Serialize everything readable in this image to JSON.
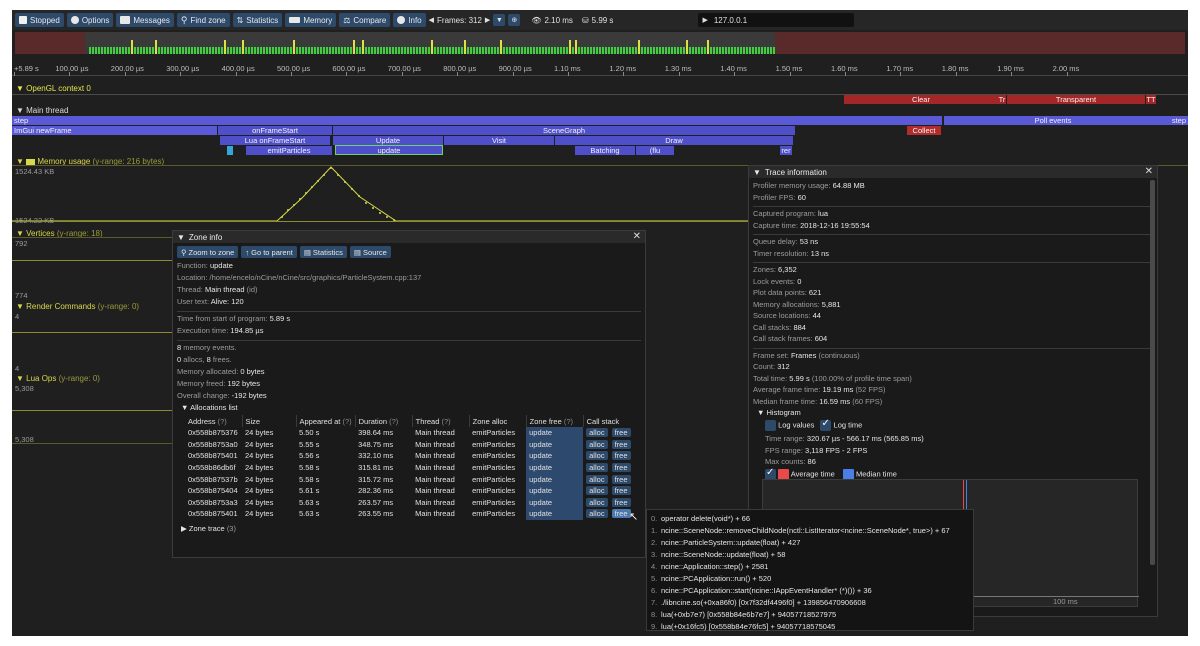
{
  "toolbar": {
    "stopped": "Stopped",
    "options": "Options",
    "messages": "Messages",
    "find_zone": "Find zone",
    "statistics": "Statistics",
    "memory": "Memory",
    "compare": "Compare",
    "info": "Info",
    "frames_label": "Frames: 312",
    "frame_time": "2.10 ms",
    "total_time": "5.99 s",
    "address": "127.0.0.1"
  },
  "ruler": {
    "ticks": [
      "+5.89 s",
      "100.00 µs",
      "200.00 µs",
      "300.00 µs",
      "400.00 µs",
      "500.00 µs",
      "600.00 µs",
      "700.00 µs",
      "800.00 µs",
      "900.00 µs",
      "1.10 ms",
      "1.20 ms",
      "1.30 ms",
      "1.40 ms",
      "1.50 ms",
      "1.60 ms",
      "1.70 ms",
      "1.80 ms",
      "1.90 ms",
      "2.00 ms"
    ]
  },
  "timeline": {
    "opengl_label": "OpenGL context 0",
    "main_thread_label": "Main thread",
    "gpu_zones": {
      "clear": "Clear",
      "tr": "Tr",
      "transparent": "Transparent",
      "tt": "TT"
    },
    "zones": {
      "step": "step",
      "poll_events": "Poll events",
      "step2": "step",
      "imgui": "ImGui newFrame",
      "on_frame_start": "onFrameStart",
      "scene_graph": "SceneGraph",
      "collect": "Collect",
      "lua_on_frame_start": "Lua onFrameStart",
      "update": "Update",
      "visit": "Visit",
      "draw": "Draw",
      "emit_particles": "emitParticles",
      "update_sel": "update",
      "batching": "Batching",
      "flu": "(flu",
      "rer": "rer"
    },
    "memory_label": "Memory usage",
    "memory_range": "(y-range: 216 bytes)",
    "memory_top": "1524.43 KB",
    "memory_bottom": "1524.22 KB",
    "vertices_label": "Vertices",
    "vertices_range": "(y-range: 18)",
    "vertices_top": "792",
    "vertices_bottom": "774",
    "render_label": "Render Commands",
    "render_range": "(y-range: 0)",
    "render_top": "4",
    "render_bottom": "4",
    "lua_label": "Lua Ops",
    "lua_range": "(y-range: 0)",
    "lua_top": "5,308",
    "lua_bottom": "5,308"
  },
  "zone_info": {
    "title": "Zone info",
    "buttons": {
      "zoom": "Zoom to zone",
      "parent": "Go to parent",
      "stats": "Statistics",
      "source": "Source"
    },
    "function_label": "Function:",
    "function": "update",
    "location_label": "Location:",
    "location": "/home/encelo/nCine/nCine/src/graphics/ParticleSystem.cpp:137",
    "thread_label": "Thread:",
    "thread": "Main thread",
    "thread_id": "(id)",
    "user_text_label": "User text:",
    "user_text": "Alive: 120",
    "time_from_start_label": "Time from start of program:",
    "time_from_start": "5.89 s",
    "exec_time_label": "Execution time:",
    "exec_time": "194.85 µs",
    "mem_events_count": "8",
    "mem_events_label": "memory events.",
    "allocs_count": "0",
    "allocs_label": "allocs,",
    "frees_count": "8",
    "frees_label": "frees.",
    "mem_alloc_label": "Memory allocated:",
    "mem_alloc": "0 bytes",
    "mem_freed_label": "Memory freed:",
    "mem_freed": "192 bytes",
    "overall_label": "Overall change:",
    "overall": "-192 bytes",
    "alloc_list_label": "Allocations list",
    "columns": [
      "Address",
      "Size",
      "Appeared at",
      "Duration",
      "Thread",
      "Zone alloc",
      "Zone free",
      "Call stack"
    ],
    "rows": [
      [
        "0x558b875376",
        "24 bytes",
        "5.50 s",
        "398.64 ms",
        "Main thread",
        "emitParticles",
        "update"
      ],
      [
        "0x558b8753a0",
        "24 bytes",
        "5.55 s",
        "348.75 ms",
        "Main thread",
        "emitParticles",
        "update"
      ],
      [
        "0x558b875401",
        "24 bytes",
        "5.56 s",
        "332.10 ms",
        "Main thread",
        "emitParticles",
        "update"
      ],
      [
        "0x558b86db6f",
        "24 bytes",
        "5.58 s",
        "315.81 ms",
        "Main thread",
        "emitParticles",
        "update"
      ],
      [
        "0x558b87537b",
        "24 bytes",
        "5.58 s",
        "315.72 ms",
        "Main thread",
        "emitParticles",
        "update"
      ],
      [
        "0x558b875404",
        "24 bytes",
        "5.61 s",
        "282.36 ms",
        "Main thread",
        "emitParticles",
        "update"
      ],
      [
        "0x558b8753a3",
        "24 bytes",
        "5.63 s",
        "263.57 ms",
        "Main thread",
        "emitParticles",
        "update"
      ],
      [
        "0x558b875401",
        "24 bytes",
        "5.63 s",
        "263.55 ms",
        "Main thread",
        "emitParticles",
        "update"
      ]
    ],
    "alloc_btn": "alloc",
    "free_btn": "free",
    "zone_trace_label": "Zone trace",
    "zone_trace_count": "(3)"
  },
  "trace_info": {
    "title": "Trace information",
    "profiler_mem_label": "Profiler memory usage:",
    "profiler_mem": "64.88 MB",
    "profiler_fps_label": "Profiler FPS:",
    "profiler_fps": "60",
    "captured_program_label": "Captured program:",
    "captured_program": "lua",
    "capture_time_label": "Capture time:",
    "capture_time": "2018-12-16 19:55:54",
    "queue_delay_label": "Queue delay:",
    "queue_delay": "53 ns",
    "timer_res_label": "Timer resolution:",
    "timer_res": "13 ns",
    "zones_label": "Zones:",
    "zones": "6,352",
    "lock_events_label": "Lock events:",
    "lock_events": "0",
    "plot_points_label": "Plot data points:",
    "plot_points": "621",
    "mem_allocs_label": "Memory allocations:",
    "mem_allocs": "5,881",
    "source_loc_label": "Source locations:",
    "source_loc": "44",
    "call_stacks_label": "Call stacks:",
    "call_stacks": "884",
    "call_stack_frames_label": "Call stack frames:",
    "call_stack_frames": "604",
    "frame_set_label": "Frame set:",
    "frame_set": "Frames",
    "frame_set_mode": "(continuous)",
    "count_label": "Count:",
    "count": "312",
    "total_time_label": "Total time:",
    "total_time": "5.99 s",
    "total_time_pct": "(100.00% of profile time span)",
    "avg_frame_label": "Average frame time:",
    "avg_frame": "19.19 ms",
    "avg_fps": "(52 FPS)",
    "median_frame_label": "Median frame time:",
    "median_frame": "16.59 ms",
    "median_fps": "(60 FPS)",
    "histogram_label": "Histogram",
    "log_values": "Log values",
    "log_time": "Log time",
    "time_range_label": "Time range:",
    "time_range": "320.67 µs - 566.17 ms (565.85 ms)",
    "fps_range_label": "FPS range:",
    "fps_range": "3,118 FPS - 2 FPS",
    "max_counts_label": "Max counts:",
    "max_counts": "86",
    "average_time": "Average time",
    "median_time": "Median time",
    "hist_axis": "100 ms",
    "colors": {
      "average": "#e84a4a",
      "median": "#4a7fe8"
    }
  },
  "tooltip": {
    "lines": [
      {
        "n": "0.",
        "t": "operator delete(void*) + 66"
      },
      {
        "n": "1.",
        "t": "ncine::SceneNode::removeChildNode(nctl::ListIterator<ncine::SceneNode*, true>) + 67"
      },
      {
        "n": "2.",
        "t": "ncine::ParticleSystem::update(float) + 427"
      },
      {
        "n": "3.",
        "t": "ncine::SceneNode::update(float) + 58"
      },
      {
        "n": "4.",
        "t": "ncine::Application::step() + 2581"
      },
      {
        "n": "5.",
        "t": "ncine::PCApplication::run() + 520"
      },
      {
        "n": "6.",
        "t": "ncine::PCApplication::start(ncine::IAppEventHandler* (*)()) + 36"
      },
      {
        "n": "7.",
        "t": "./libncine.so(+0xa86f0) [0x7f32df4496f0] + 139856470906608"
      },
      {
        "n": "8.",
        "t": "lua(+0xb7e7) [0x558b84e6b7e7] + 94057718527975"
      },
      {
        "n": "9.",
        "t": "lua(+0x16fc5) [0x558b84e76fc5] + 94057718575045"
      }
    ]
  }
}
